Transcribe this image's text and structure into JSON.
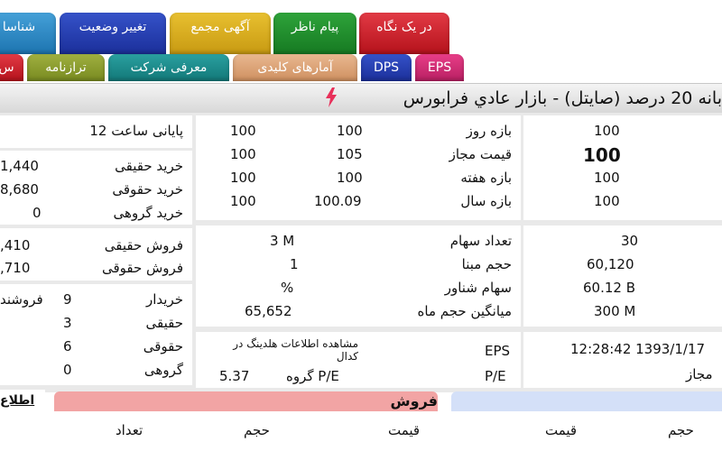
{
  "tabs_row1": [
    {
      "label": "در یک نگاه",
      "color": "#c8192a"
    },
    {
      "label": "پیام ناظر",
      "color": "#1f8a2b"
    },
    {
      "label": "آگهی مجمع",
      "color": "#d6ab1c"
    },
    {
      "label": "تغییر وضعیت",
      "color": "#2540b0"
    },
    {
      "label": "شناسا",
      "color": "#2f8ad0"
    }
  ],
  "tabs_row2": [
    {
      "label": "EPS",
      "color": "#d42a6e"
    },
    {
      "label": "DPS",
      "color": "#2540b0"
    },
    {
      "label": "آمارهای کلیدی",
      "color": "#d9a070"
    },
    {
      "label": "معرفی شرکت",
      "color": "#1f8a8a"
    },
    {
      "label": "ترازنامه",
      "color": "#8ea032"
    },
    {
      "label": "س",
      "color": "#c8192a"
    }
  ],
  "title": "بانه 20 درصد (صایتل) - بازار عادي فرابورس",
  "icons": {
    "bolt": "lightning-icon"
  },
  "stats_left": {
    "closing_label": "پایانی ساعت 12",
    "buy_real_label": "خرید حقیقی",
    "buy_real_value": "1,440",
    "buy_legal_label": "خرید حقوقی",
    "buy_legal_value": "8,680",
    "buy_group_label": "خرید گروهی",
    "buy_group_value": "0",
    "sell_real_label": "فروش حقیقی",
    "sell_real_value": ",410",
    "sell_legal_label": "فروش حقوقی",
    "sell_legal_value": ",710",
    "buyer_label": "خریدار",
    "buyer_value": "9",
    "seller_label": "فروشند",
    "real_label": "حقیقی",
    "real_value": "3",
    "legal_label": "حقوقی",
    "legal_value": "6",
    "group_label": "گروهی",
    "group_value": "0"
  },
  "range_table": {
    "rows": [
      {
        "label": "بازه روز",
        "low": "100",
        "high": "100",
        "ref": "100"
      },
      {
        "label": "قیمت مجاز",
        "low": "100",
        "high": "105",
        "ref": "100"
      },
      {
        "label": "بازه هفته",
        "low": "100",
        "high": "100",
        "ref": "100"
      },
      {
        "label": "بازه سال",
        "low": "100",
        "high": "100.09",
        "ref": "100"
      }
    ]
  },
  "share_info": {
    "shares_label": "تعداد سهام",
    "shares_value": "3 M",
    "shares_right": "30",
    "base_vol_label": "حجم مبنا",
    "base_vol_value": "1",
    "base_vol_right": "60,120",
    "float_label": "سهام شناور",
    "float_value": "%",
    "float_right": "60.12 B",
    "avg_vol_label": "میانگین حجم ماه",
    "avg_vol_value": "65,652",
    "avg_vol_right": "300 M"
  },
  "eps_block": {
    "codal_label": "مشاهده اطلاعات هلدینگ در کدال",
    "eps_label": "EPS",
    "group_pe_label": "P/E گروه",
    "group_pe_value": "5.37",
    "pe_label": "P/E",
    "datetime": "12:28:42 1393/1/17",
    "allowed_label": "مجاز"
  },
  "orderbook": {
    "sell_title": "فروش",
    "sell_cols": [
      "قیمت",
      "حجم",
      "تعداد"
    ],
    "buy_cols": [
      "قیمت",
      "حجم"
    ],
    "info_label": "اطلاع"
  }
}
